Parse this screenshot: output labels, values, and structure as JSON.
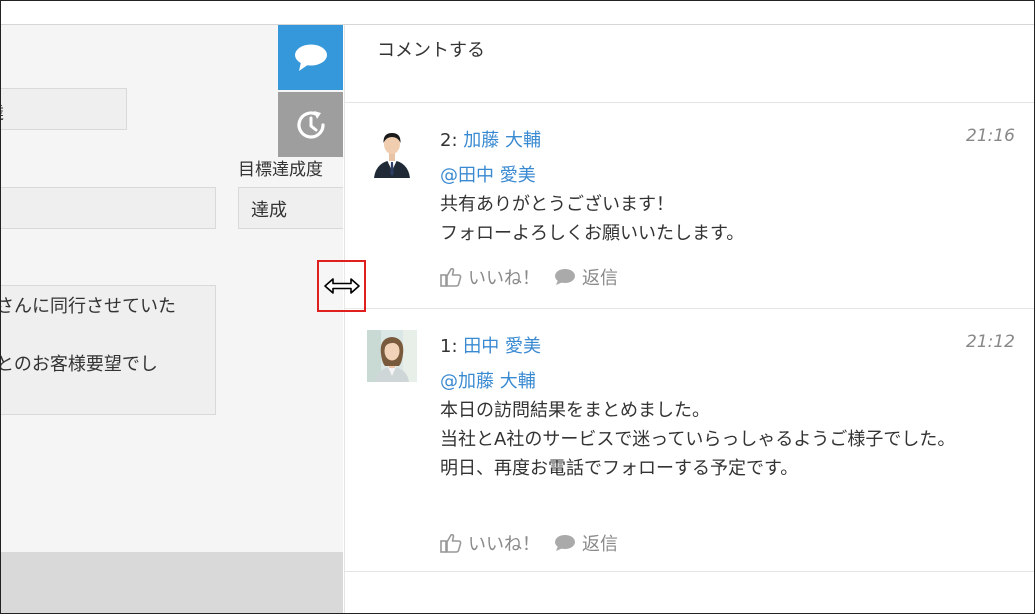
{
  "left_panel": {
    "field1_value": "達",
    "target_label": "目標達成度",
    "target_value": "達成",
    "report_lines": [
      "問さんに同行させていた",
      "",
      "いとのお客様要望でし"
    ]
  },
  "side_tabs": [
    {
      "icon": "speech-bubble-icon",
      "color": "#3498db"
    },
    {
      "icon": "history-clock-icon",
      "color": "#9e9e9e"
    }
  ],
  "comment_box": {
    "placeholder": "コメントする"
  },
  "comments": [
    {
      "number": "2:",
      "author": "加藤 大輔",
      "time": "21:16",
      "mention": "@田中 愛美",
      "lines": [
        "共有ありがとうございます！",
        "フォローよろしくお願いいたします。"
      ],
      "like_label": "いいね！",
      "reply_label": "返信"
    },
    {
      "number": "1:",
      "author": "田中 愛美",
      "time": "21:12",
      "mention": "@加藤 大輔",
      "lines": [
        "本日の訪問結果をまとめました。",
        "当社とA社のサービスで迷っていらっしゃるようご様子でした。",
        "明日、再度お電話でフォローする予定です。"
      ],
      "like_label": "いいね！",
      "reply_label": "返信"
    }
  ],
  "colors": {
    "accent": "#3498db",
    "link": "#3a8ad2",
    "highlight": "#e0201f"
  }
}
